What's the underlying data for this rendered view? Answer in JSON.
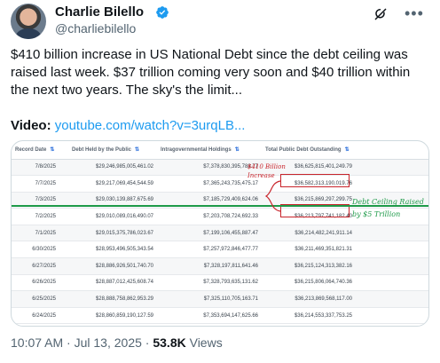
{
  "author": {
    "name": "Charlie Bilello",
    "handle": "@charliebilello"
  },
  "tweet": {
    "text": "$410 billion increase in US National Debt since the debt ceiling was raised last week. $37 trillion coming very soon and $40 trillion within the next two years. The sky's the limit...",
    "video_label": "Video:",
    "video_link": "youtube.com/watch?v=3urqLB..."
  },
  "table": {
    "headers": [
      "Record Date",
      "Debt Held by the Public",
      "Intragovernmental Holdings",
      "Total Public Debt Outstanding"
    ],
    "rows": [
      [
        "7/8/2025",
        "$29,246,985,005,461.02",
        "$7,378,830,395,788.77",
        "$36,625,815,401,249.79"
      ],
      [
        "7/7/2025",
        "$29,217,069,454,544.59",
        "$7,365,243,735,475.17",
        "$36,582,313,190,019.76"
      ],
      [
        "7/3/2025",
        "$29,030,139,887,675.69",
        "$7,185,729,409,624.06",
        "$36,215,869,297,299.75"
      ],
      [
        "7/2/2025",
        "$29,010,089,016,490.07",
        "$7,203,708,724,692.33",
        "$36,213,797,741,182.40"
      ],
      [
        "7/1/2025",
        "$29,015,375,786,023.67",
        "$7,199,106,455,887.47",
        "$36,214,482,241,911.14"
      ],
      [
        "6/30/2025",
        "$28,953,496,505,343.54",
        "$7,257,972,846,477.77",
        "$36,211,469,351,821.31"
      ],
      [
        "6/27/2025",
        "$28,886,926,501,740.70",
        "$7,328,197,811,641.46",
        "$36,215,124,313,382.16"
      ],
      [
        "6/26/2025",
        "$28,887,012,425,608.74",
        "$7,328,793,635,131.62",
        "$36,215,806,064,740.36"
      ],
      [
        "6/25/2025",
        "$28,888,758,862,953.29",
        "$7,325,110,705,163.71",
        "$36,213,869,568,117.00"
      ],
      [
        "6/24/2025",
        "$28,860,859,190,127.59",
        "$7,353,694,147,625.66",
        "$36,214,553,337,753.25"
      ]
    ],
    "annotation_increase": "$410 Billion Increase",
    "annotation_ceiling": "Debt Ceiling Raised by $5 Trillion"
  },
  "meta": {
    "time": "10:07 AM",
    "separator": "·",
    "date": "Jul 13, 2025",
    "views_count": "53.8K",
    "views_label": "Views"
  },
  "colors": {
    "link": "#1d9bf0",
    "verified": "#1d9bf0",
    "annotation_red": "#c8242b",
    "annotation_green": "#1e9a49"
  },
  "icons": [
    "verified-badge-icon",
    "grok-icon",
    "more-icon",
    "sort-icon"
  ]
}
